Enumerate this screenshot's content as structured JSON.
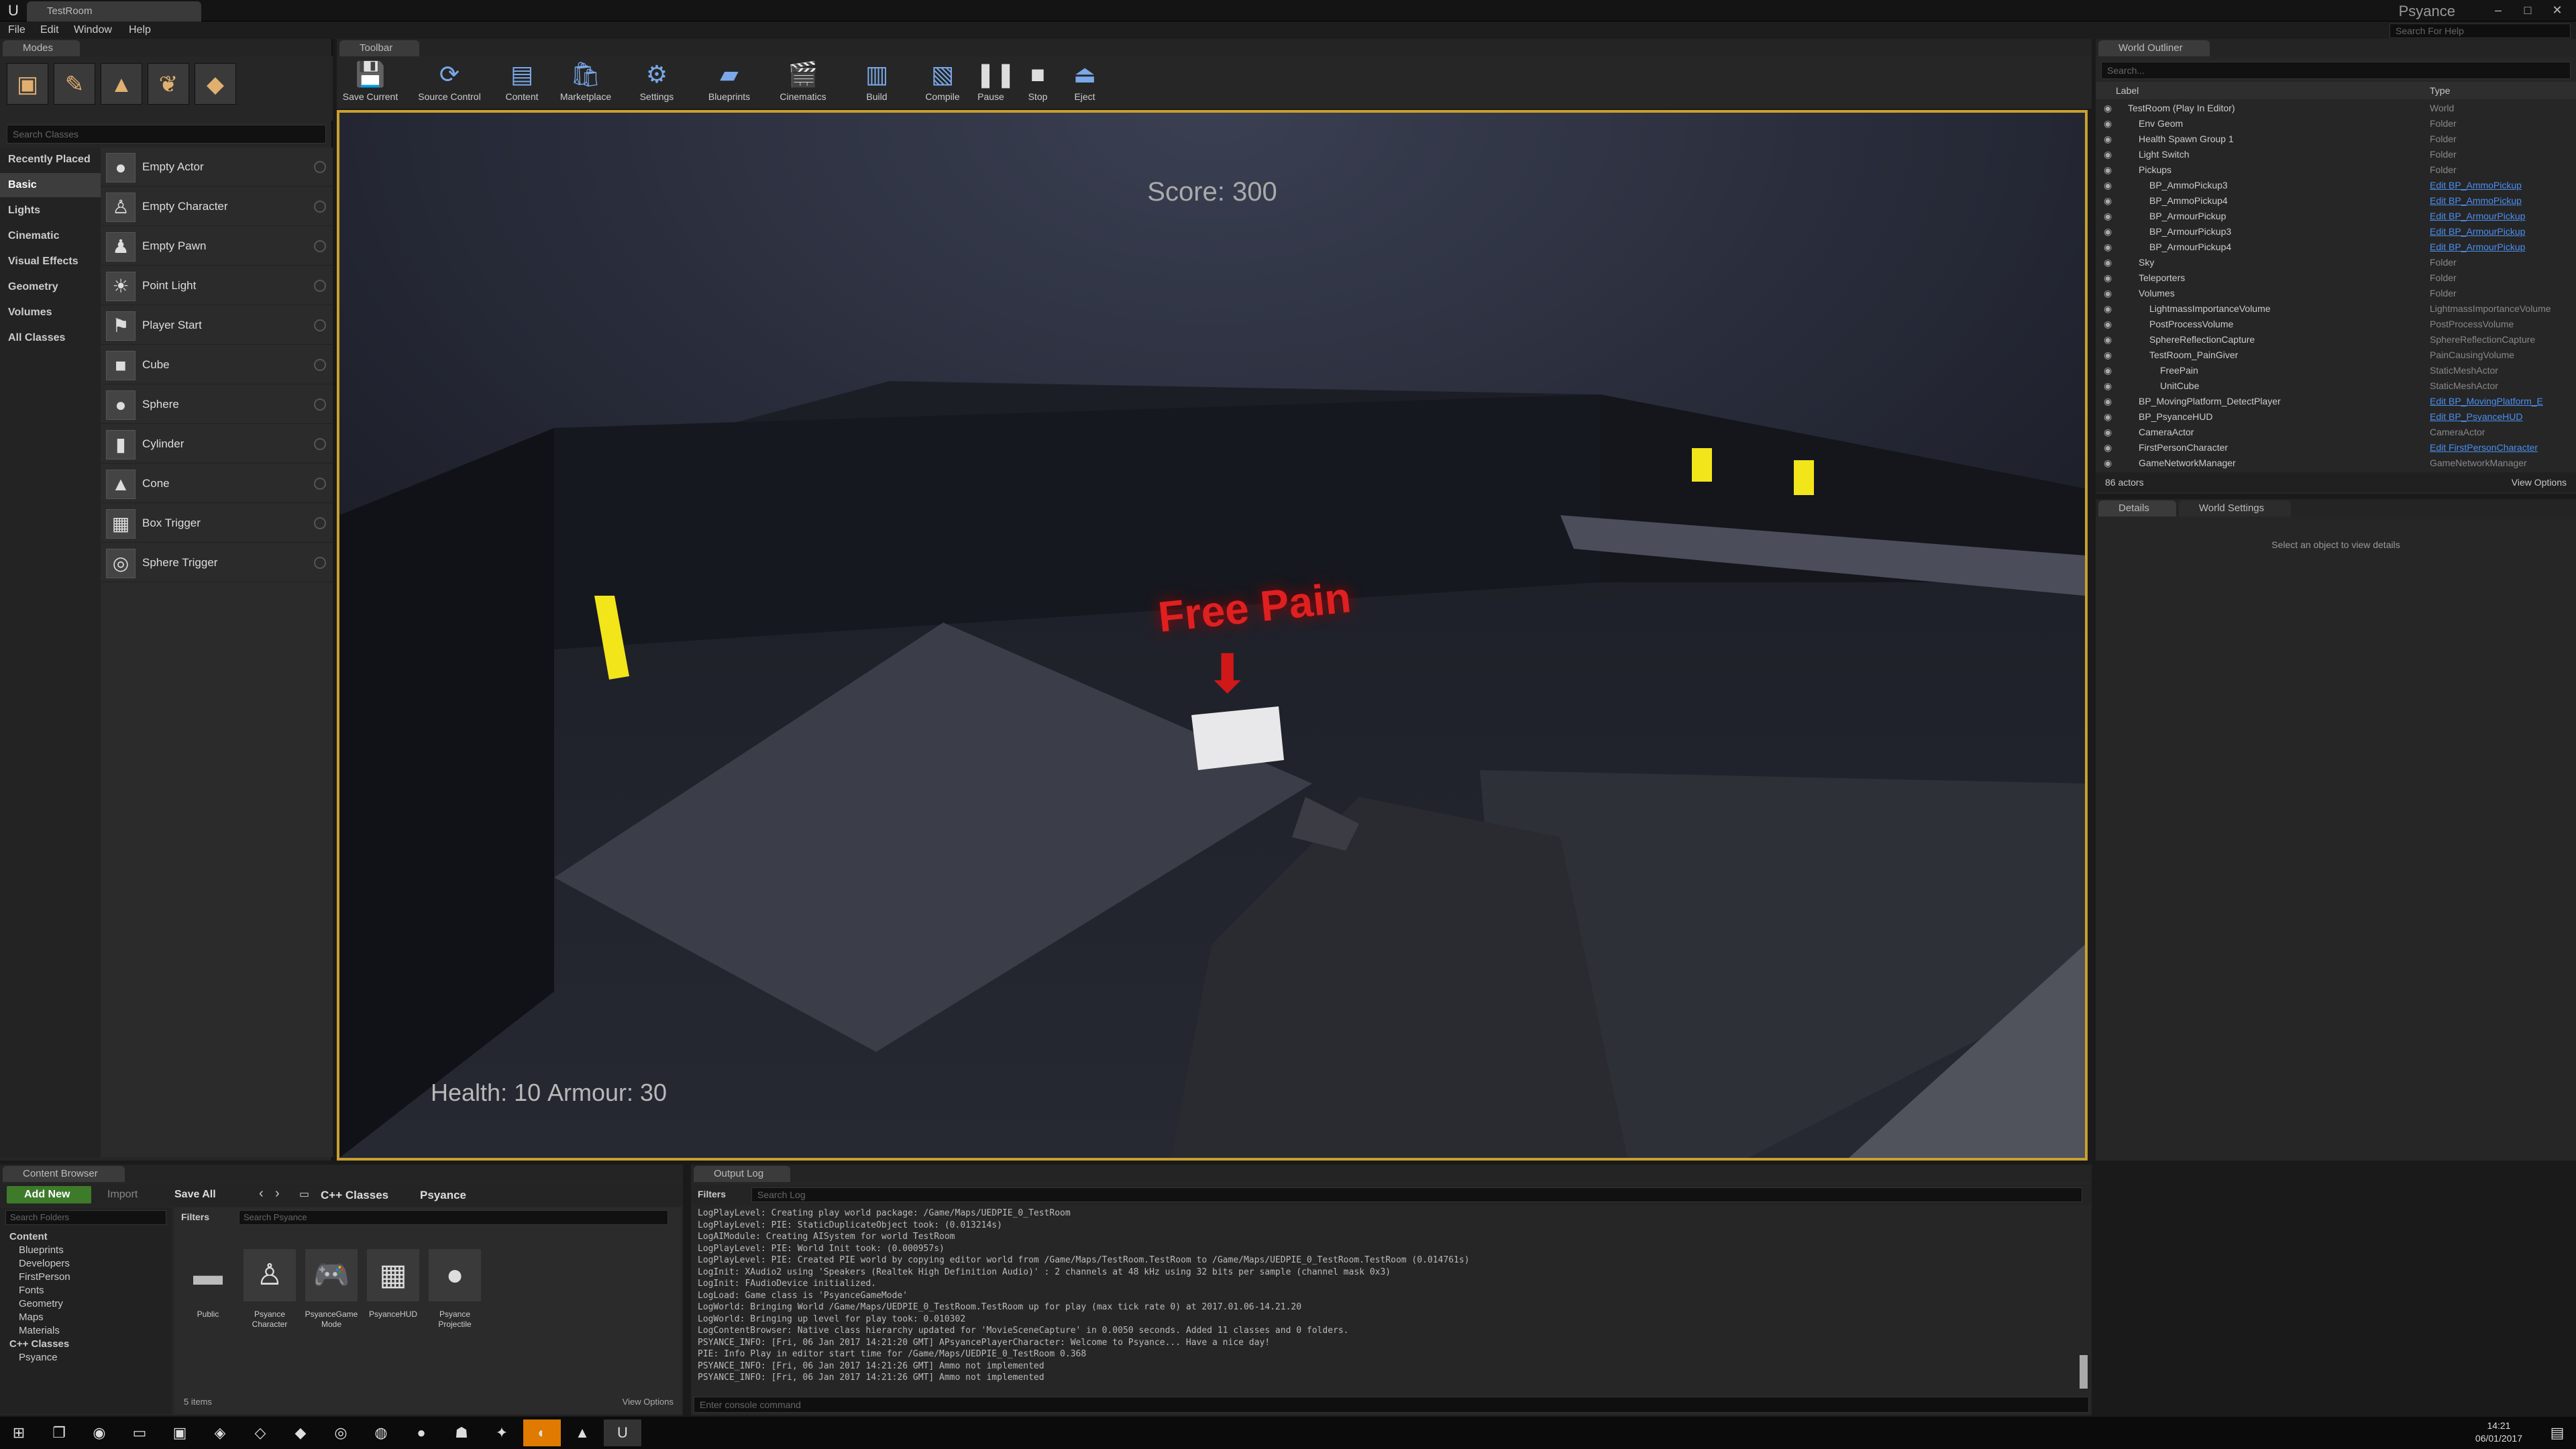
{
  "window": {
    "tab": "TestRoom",
    "project": "Psyance",
    "help_search": "Search For Help"
  },
  "menu": [
    "File",
    "Edit",
    "Window",
    "Help"
  ],
  "modes": {
    "tab": "Modes",
    "search_placeholder": "Search Classes",
    "categories": [
      "Recently Placed",
      "Basic",
      "Lights",
      "Cinematic",
      "Visual Effects",
      "Geometry",
      "Volumes",
      "All Classes"
    ],
    "items": [
      "Empty Actor",
      "Empty Character",
      "Empty Pawn",
      "Point Light",
      "Player Start",
      "Cube",
      "Sphere",
      "Cylinder",
      "Cone",
      "Box Trigger",
      "Sphere Trigger"
    ]
  },
  "toolbar": {
    "tab": "Toolbar",
    "buttons": [
      "Save Current",
      "Source Control",
      "Content",
      "Marketplace",
      "Settings",
      "Blueprints",
      "Cinematics",
      "Build",
      "Compile",
      "Pause",
      "Stop",
      "Eject"
    ]
  },
  "viewport": {
    "score": "Score: 300",
    "health": "Health: 10",
    "armour": "Armour: 30",
    "sign": "Free Pain"
  },
  "outliner": {
    "tab": "World Outliner",
    "search_placeholder": "Search...",
    "col_label": "Label",
    "col_type": "Type",
    "rows": [
      {
        "name": "TestRoom (Play In Editor)",
        "type": "World",
        "indent": 0,
        "link": false
      },
      {
        "name": "Env Geom",
        "type": "Folder",
        "indent": 1,
        "link": false
      },
      {
        "name": "Health Spawn Group 1",
        "type": "Folder",
        "indent": 1,
        "link": false
      },
      {
        "name": "Light Switch",
        "type": "Folder",
        "indent": 1,
        "link": false
      },
      {
        "name": "Pickups",
        "type": "Folder",
        "indent": 1,
        "link": false
      },
      {
        "name": "BP_AmmoPickup3",
        "type": "Edit BP_AmmoPickup",
        "indent": 2,
        "link": true
      },
      {
        "name": "BP_AmmoPickup4",
        "type": "Edit BP_AmmoPickup",
        "indent": 2,
        "link": true
      },
      {
        "name": "BP_ArmourPickup",
        "type": "Edit BP_ArmourPickup",
        "indent": 2,
        "link": true
      },
      {
        "name": "BP_ArmourPickup3",
        "type": "Edit BP_ArmourPickup",
        "indent": 2,
        "link": true
      },
      {
        "name": "BP_ArmourPickup4",
        "type": "Edit BP_ArmourPickup",
        "indent": 2,
        "link": true
      },
      {
        "name": "Sky",
        "type": "Folder",
        "indent": 1,
        "link": false
      },
      {
        "name": "Teleporters",
        "type": "Folder",
        "indent": 1,
        "link": false
      },
      {
        "name": "Volumes",
        "type": "Folder",
        "indent": 1,
        "link": false
      },
      {
        "name": "LightmassImportanceVolume",
        "type": "LightmassImportanceVolume",
        "indent": 2,
        "link": false
      },
      {
        "name": "PostProcessVolume",
        "type": "PostProcessVolume",
        "indent": 2,
        "link": false
      },
      {
        "name": "SphereReflectionCapture",
        "type": "SphereReflectionCapture",
        "indent": 2,
        "link": false
      },
      {
        "name": "TestRoom_PainGiver",
        "type": "PainCausingVolume",
        "indent": 2,
        "link": false
      },
      {
        "name": "FreePain",
        "type": "StaticMeshActor",
        "indent": 3,
        "link": false
      },
      {
        "name": "UnitCube",
        "type": "StaticMeshActor",
        "indent": 3,
        "link": false
      },
      {
        "name": "BP_MovingPlatform_DetectPlayer",
        "type": "Edit BP_MovingPlatform_E",
        "indent": 1,
        "link": true
      },
      {
        "name": "BP_PsyanceHUD",
        "type": "Edit BP_PsyanceHUD",
        "indent": 1,
        "link": true
      },
      {
        "name": "CameraActor",
        "type": "CameraActor",
        "indent": 1,
        "link": false
      },
      {
        "name": "FirstPersonCharacter",
        "type": "Edit FirstPersonCharacter",
        "indent": 1,
        "link": true
      },
      {
        "name": "GameNetworkManager",
        "type": "GameNetworkManager",
        "indent": 1,
        "link": false
      }
    ],
    "count": "86 actors",
    "view_options": "View Options"
  },
  "details": {
    "tab": "Details",
    "tab2": "World Settings",
    "empty": "Select an object to view details"
  },
  "content_browser": {
    "tab": "Content Browser",
    "add_new": "Add New",
    "import": "Import",
    "save_all": "Save All",
    "path": [
      "C++ Classes",
      "Psyance"
    ],
    "folder_search": "Search Folders",
    "filters": "Filters",
    "asset_search": "Search Psyance",
    "folders": [
      {
        "name": "Content",
        "indent": 0
      },
      {
        "name": "Blueprints",
        "indent": 1
      },
      {
        "name": "Developers",
        "indent": 1
      },
      {
        "name": "FirstPerson",
        "indent": 1
      },
      {
        "name": "Fonts",
        "indent": 1
      },
      {
        "name": "Geometry",
        "indent": 1
      },
      {
        "name": "Maps",
        "indent": 1
      },
      {
        "name": "Materials",
        "indent": 1
      },
      {
        "name": "C++ Classes",
        "indent": 0
      },
      {
        "name": "Psyance",
        "indent": 1
      }
    ],
    "assets": [
      "Public",
      "Psyance Character",
      "PsyanceGame Mode",
      "PsyanceHUD",
      "Psyance Projectile"
    ],
    "count": "5 items",
    "view_options": "View Options"
  },
  "output_log": {
    "tab": "Output Log",
    "filters": "Filters",
    "search_placeholder": "Search Log",
    "console_placeholder": "Enter console command",
    "lines": [
      "LogPlayLevel: Creating play world package: /Game/Maps/UEDPIE_0_TestRoom",
      "LogPlayLevel: PIE: StaticDuplicateObject took: (0.013214s)",
      "LogAIModule: Creating AISystem for world TestRoom",
      "LogPlayLevel: PIE: World Init took: (0.000957s)",
      "LogPlayLevel: PIE: Created PIE world by copying editor world from /Game/Maps/TestRoom.TestRoom to /Game/Maps/UEDPIE_0_TestRoom.TestRoom (0.014761s)",
      "LogInit: XAudio2 using 'Speakers (Realtek High Definition Audio)' : 2 channels at 48 kHz using 32 bits per sample (channel mask 0x3)",
      "LogInit: FAudioDevice initialized.",
      "LogLoad: Game class is 'PsyanceGameMode'",
      "LogWorld: Bringing World /Game/Maps/UEDPIE_0_TestRoom.TestRoom up for play (max tick rate 0) at 2017.01.06-14.21.20",
      "LogWorld: Bringing up level for play took: 0.010302",
      "LogContentBrowser: Native class hierarchy updated for 'MovieSceneCapture' in 0.0050 seconds. Added 11 classes and 0 folders.",
      "PSYANCE_INFO: [Fri, 06 Jan 2017 14:21:20 GMT] APsyancePlayerCharacter: Welcome to Psyance... Have a nice day!",
      "PIE: Info Play in editor start time for /Game/Maps/UEDPIE_0_TestRoom 0.368",
      "PSYANCE_INFO: [Fri, 06 Jan 2017 14:21:26 GMT] Ammo not implemented",
      "PSYANCE_INFO: [Fri, 06 Jan 2017 14:21:26 GMT] Ammo not implemented"
    ]
  },
  "taskbar": {
    "time": "14:21",
    "date": "06/01/2017"
  }
}
